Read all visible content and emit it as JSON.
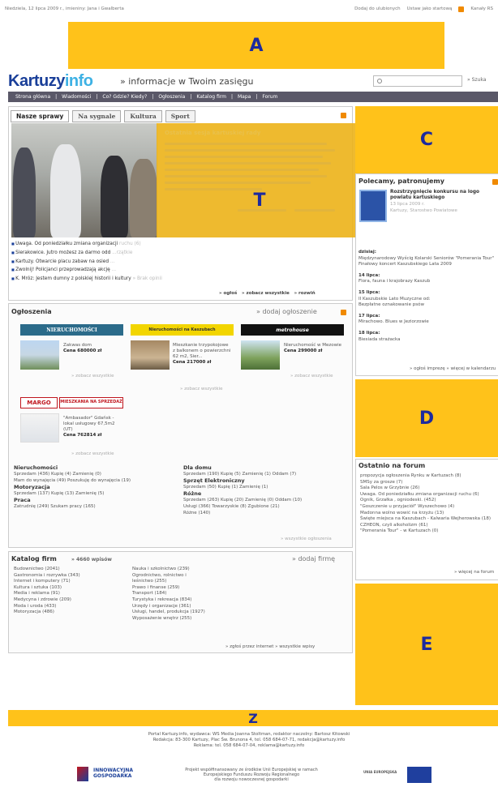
{
  "topbar": {
    "date_text": "Niedziela, 12 lipca 2009 r., imieniny: Jana i Gwalberta",
    "fav": "Dodaj do ulubionych",
    "home": "Ustaw jako startową",
    "rss": "Kanały RS"
  },
  "ad_blocks": {
    "a": "A",
    "c": "C",
    "d": "D",
    "e": "E",
    "t": "T",
    "z": "Z"
  },
  "header": {
    "logo_k": "Kartuzy",
    "logo_info": "info",
    "tagline": "» informacje w Twoim zasięgu",
    "search_btn": "» Szuka"
  },
  "nav": [
    "Strona główna",
    "|",
    "Wiadomości",
    "|",
    "Co? Gdzie? Kiedy?",
    "|",
    "Ogłoszenia",
    "|",
    "Katalog firm",
    "|",
    "Mapa",
    "|",
    "Forum"
  ],
  "news": {
    "tabs": [
      "Nasze sprawy",
      "Na sygnale",
      "Kultura",
      "Sport"
    ],
    "overlay_title": "Ostatnia sesja kartuskiej rady",
    "items": [
      {
        "text": "Uwaga. Od poniedziałku zmiana organizacji",
        "faded": "ruchu (6)"
      },
      {
        "text": "Sierakowice. Jutro możesz za darmo odd",
        "faded": "...rzątkie"
      },
      {
        "text": "Kartuzy. Otwarcie placu zabaw na osied",
        "faded": "..."
      },
      {
        "text": "Zwolnij! Policjanci przeprowadzają akcję",
        "faded": "..."
      },
      {
        "text": "K. Mróz: Jestem dumny z polskiej historii i kultury",
        "faded": "» Brak opinii"
      }
    ],
    "links": [
      "» ogłoś",
      "» zobacz wszystkie",
      "» rozwiń"
    ]
  },
  "ogloszenia": {
    "title": "Ogłoszenia",
    "add": "» dodaj ogłoszenie",
    "banners": [
      "NIERUCHOMOŚCI",
      "Nieruchomości na Kaszubach",
      "metrohouse",
      "MARGO",
      "MIESZKANIA NA SPRZEDAŻ"
    ],
    "ads": [
      {
        "desc": "Zakwas dom",
        "price": "Cena 680000 zł"
      },
      {
        "desc": "Mieszkanie trzypokojowe z balkonem o powierzchni 62 m2, Sier...",
        "price": "Cena 217000 zł"
      },
      {
        "desc": "Nieruchomość w Mezowie",
        "price": "Cena 299000 zł"
      },
      {
        "desc": "\"Ambasador\" Gdańsk - lokal usługowy 67,5m2 (UT)",
        "price": "Cena 762814 zł"
      }
    ],
    "see_all": "» zobacz wszystkie",
    "cats_left": [
      {
        "h": "Nieruchomości",
        "lines": [
          "Sprzedam (436) Kupię (4) Zamienię (0)",
          "Mam do wynajęcia (49) Poszukuję do wynajęcia (19)"
        ]
      },
      {
        "h": "Motoryzacja",
        "lines": [
          "Sprzedam (137) Kupię (13) Zamienię (5)"
        ]
      },
      {
        "h": "Praca",
        "lines": [
          "Zatrudnię (249) Szukam pracy (165)"
        ]
      }
    ],
    "cats_right": [
      {
        "h": "Dla domu",
        "lines": [
          "Sprzedam (190) Kupię (5) Zamienię (1) Oddam (7)"
        ]
      },
      {
        "h": "Sprzęt Elektroniczny",
        "lines": [
          "Sprzedam (50) Kupię (1) Zamienię (1)"
        ]
      },
      {
        "h": "Różne",
        "lines": [
          "Sprzedam (263) Kupię (20) Zamienię (0) Oddam (10)",
          "Usługi (366) Towarzyskie (8) Zgubione (21)",
          "Różne (140)"
        ]
      }
    ],
    "all_ads": "» wszystkie ogłoszenia"
  },
  "katalog": {
    "title": "Katalog firm",
    "count": "» 4660 wpisów",
    "add": "» dodaj firmę",
    "left": [
      "Budownictwo (2041)",
      "Gastronomia i rozrywka (343)",
      "Internet i komputery (71)",
      "Kultura i sztuka (103)",
      "Media i reklama (91)",
      "Medycyna i zdrowie (209)",
      "Moda i uroda (433)",
      "Motoryzacja (486)"
    ],
    "right": [
      "Nauka i szkolnictwo (239)",
      "Ogrodnictwo, rolnictwo i",
      "leśnictwo (255)",
      "Prawo i finanse (259)",
      "Transport (184)",
      "Turystyka i rekreacja (834)",
      "Urzędy i organizacje (361)",
      "Usługi, handel, produkcja (1927)",
      "Wyposażenie wnętrz (255)"
    ],
    "links": "» zgłoś przez internet   » wszystkie wpisy"
  },
  "polecamy": {
    "title": "Polecamy, patronujemy",
    "headline": "Rozstrzygnięcie konkursu na logo powiatu kartuskiego",
    "date": "13 lipca 2009 r.",
    "sub": "Kartuzy, Starostwo Powiatowe",
    "today": "dzisiaj:",
    "today_items": [
      "Międzynarodowy Wyścig Kolarski Seniorów \"Pomerania Tour\"",
      "Finałowy koncert Kaszubskiego Lata 2009"
    ],
    "d14": "14 lipca:",
    "d14_items": [
      "Flora, fauna i krajobrazy Kaszub"
    ],
    "d15": "15 lipca:",
    "d15_items": [
      "II Kaszubskie Lato Muzyczne od:",
      "Bezpłatne oznakowanie psów"
    ],
    "d17": "17 lipca:",
    "d17_items": [
      "Mirachowo. Blues w Jeziorzowie"
    ],
    "d18": "18 lipca:",
    "d18_items": [
      "Biesiada strażacka"
    ],
    "links": "» ogłoś imprezę   » więcej w kalendarzu"
  },
  "forum": {
    "title": "Ostatnio na forum",
    "items": [
      "propozycja ogłoszenia Rynku w Kartuzach (8)",
      "SMSy za grosze (7)",
      "Sala Pelos w Grzybnie (26)",
      "Uwaga. Od poniedziałku zmiana organizacji ruchu (6)",
      "Ognik, Grzałka , ogniodeski. (452)",
      "\"Goszczenie u przyjaciół\" Wyszechowo (4)",
      "Madonna wolno wowić na krzyżu (13)",
      "Święte miejsca na Kaszubach - Kalwaria Wejherowska (18)",
      "CZHEON, czyli alkoholizm (61)",
      "\"Pomerania Tour\" - w Kartuzach (0)"
    ],
    "more": "» więcej na forum"
  },
  "footer": {
    "l1": "Portal Kartuzy.info, wydawca: WS Media Joanna Stoltman, redaktor naczelny: Bartosz Kitowski",
    "l2": "Redakcja: 83-300 Kartuzy, Plac Św. Brunona 4, tel. 058 684-07-71, redakcja@kartuzy.info",
    "l3": "Reklama: tel. 058 684-07-04, reklama@kartuzy.info",
    "innowacyjna": "INNOWACYJNA",
    "gospodarka": "GOSPODARKA",
    "project": "Projekt współfinansowany ze środków Unii Europejskiej w ramach Europejskiego Funduszu Rozwoju Regionalnego",
    "project2": "dla rozwoju nowoczesnej gospodarki",
    "ue": "UNIA EUROPEJSKA"
  }
}
